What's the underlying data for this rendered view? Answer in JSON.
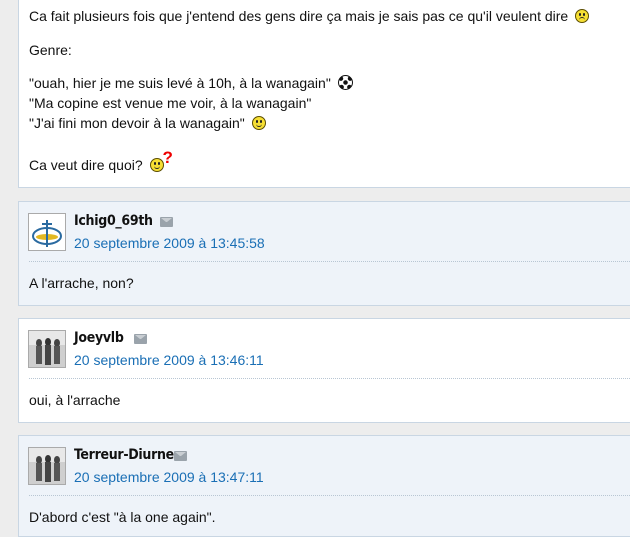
{
  "first_post": {
    "line1": "Ca fait plusieurs fois que j'entend des gens dire ça mais je sais pas ce qu'il veulent dire",
    "line2": "Genre:",
    "quote1": "\"ouah, hier je me suis levé à 10h, à la wanagain\"",
    "quote2": "\"Ma copine est venue me voir, à la wanagain\"",
    "quote3": "\"J'ai fini mon devoir à la wanagain\"",
    "question": "Ca veut dire quoi?",
    "qmark": "?"
  },
  "posts": [
    {
      "username": "Ichig0_69th",
      "date": "20 septembre 2009 à 13:45:58",
      "content": "A l'arrache, non?"
    },
    {
      "username": "Joeyvlb",
      "date": "20 septembre 2009 à 13:46:11",
      "content": "oui, à l'arrache"
    },
    {
      "username": "Terreur-Diurne",
      "date": "20 septembre 2009 à 13:47:11",
      "content": "D'abord c'est \"à la one again\"."
    }
  ]
}
